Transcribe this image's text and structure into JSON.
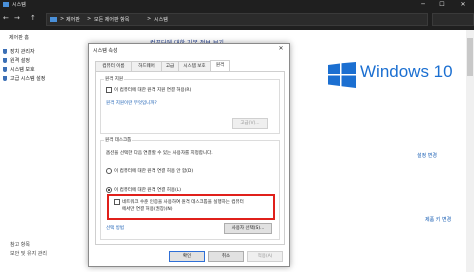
{
  "window": {
    "title": "시스템",
    "minimize": "─",
    "maximize": "☐",
    "close": "✕"
  },
  "address": {
    "back": "←",
    "forward": "→",
    "up": "↑",
    "crumbs": [
      "제어판",
      "모든 제어판 항목",
      "시스템"
    ],
    "separator": ">"
  },
  "sidebar": {
    "home": "제어판 홈",
    "items": [
      {
        "label": "장치 관리자"
      },
      {
        "label": "원격 설정"
      },
      {
        "label": "시스템 보호"
      },
      {
        "label": "고급 시스템 설정"
      }
    ],
    "see_also": "참고 항목",
    "security": "보안 및 유지 관리"
  },
  "main": {
    "heading": "컴퓨터에 대한 기본 정보 보기",
    "brand": "Windows 10",
    "change_settings": "설정 변경",
    "change_key": "제품 키 변경"
  },
  "dialog": {
    "title": "시스템 속성",
    "close": "✕",
    "tabs": [
      {
        "label": "컴퓨터 이름"
      },
      {
        "label": "하드웨어"
      },
      {
        "label": "고급"
      },
      {
        "label": "시스템 보호"
      },
      {
        "label": "원격"
      }
    ],
    "assist_group": "원격 지원",
    "assist_checkbox": "이 컴퓨터에 대한 원격 지원 연결 허용(R)",
    "assist_link": "원격 지원이란 무엇입니까?",
    "advanced_button": "고급(V)...",
    "desktop_group": "원격 데스크톱",
    "desktop_desc": "옵션을 선택한 다음 연결할 수 있는 사용자를 지정합니다.",
    "radio_deny": "이 컴퓨터에 대한 원격 연결 허용 안 함(D)",
    "radio_allow": "이 컴퓨터에 대한 원격 연결 허용(L)",
    "nla_line1": "네트워크 수준 인증을 사용하여 원격 데스크톱을 실행하는 컴퓨터",
    "nla_line2": "에서만 연결 허용(권장)(N)",
    "help_link": "선택 방법",
    "select_users": "사용자 선택(S)...",
    "ok": "확인",
    "cancel": "취소",
    "apply": "적용(A)"
  }
}
